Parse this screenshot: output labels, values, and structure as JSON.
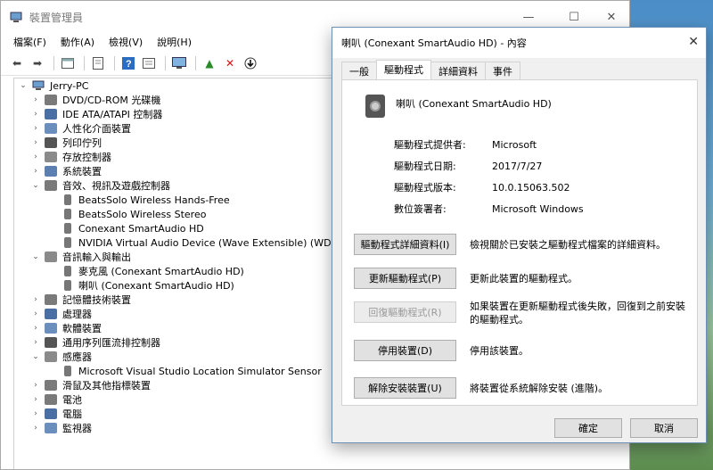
{
  "device_manager": {
    "title": "裝置管理員",
    "menu": [
      "檔案(F)",
      "動作(A)",
      "檢視(V)",
      "說明(H)"
    ],
    "tree": {
      "root": "Jerry-PC",
      "items": [
        {
          "label": "DVD/CD-ROM 光碟機",
          "state": "collapsed",
          "level": 1
        },
        {
          "label": "IDE ATA/ATAPI 控制器",
          "state": "collapsed",
          "level": 1
        },
        {
          "label": "人性化介面裝置",
          "state": "collapsed",
          "level": 1
        },
        {
          "label": "列印佇列",
          "state": "collapsed",
          "level": 1
        },
        {
          "label": "存放控制器",
          "state": "collapsed",
          "level": 1
        },
        {
          "label": "系統裝置",
          "state": "collapsed",
          "level": 1
        },
        {
          "label": "音效、視訊及遊戲控制器",
          "state": "expanded",
          "level": 1
        },
        {
          "label": "BeatsSolo Wireless Hands-Free",
          "state": "leaf",
          "level": 2
        },
        {
          "label": "BeatsSolo Wireless Stereo",
          "state": "leaf",
          "level": 2
        },
        {
          "label": "Conexant SmartAudio HD",
          "state": "leaf",
          "level": 2
        },
        {
          "label": "NVIDIA Virtual Audio Device (Wave Extensible) (WDM)",
          "state": "leaf",
          "level": 2
        },
        {
          "label": "音訊輸入與輸出",
          "state": "expanded",
          "level": 1
        },
        {
          "label": "麥克風 (Conexant SmartAudio HD)",
          "state": "leaf",
          "level": 2
        },
        {
          "label": "喇叭 (Conexant SmartAudio HD)",
          "state": "leaf",
          "level": 2
        },
        {
          "label": "記憶體技術裝置",
          "state": "collapsed",
          "level": 1
        },
        {
          "label": "處理器",
          "state": "collapsed",
          "level": 1
        },
        {
          "label": "軟體裝置",
          "state": "collapsed",
          "level": 1
        },
        {
          "label": "通用序列匯流排控制器",
          "state": "collapsed",
          "level": 1
        },
        {
          "label": "感應器",
          "state": "expanded",
          "level": 1
        },
        {
          "label": "Microsoft Visual Studio Location Simulator Sensor",
          "state": "leaf",
          "level": 2
        },
        {
          "label": "滑鼠及其他指標裝置",
          "state": "collapsed",
          "level": 1
        },
        {
          "label": "電池",
          "state": "collapsed",
          "level": 1
        },
        {
          "label": "電腦",
          "state": "collapsed",
          "level": 1
        },
        {
          "label": "監視器",
          "state": "collapsed",
          "level": 1
        }
      ]
    }
  },
  "properties_dialog": {
    "title": "喇叭 (Conexant SmartAudio HD) - 內容",
    "tabs": [
      "一般",
      "驅動程式",
      "詳細資料",
      "事件"
    ],
    "active_tab": "驅動程式",
    "device_name": "喇叭 (Conexant SmartAudio HD)",
    "fields": [
      {
        "key": "驅動程式提供者:",
        "value": "Microsoft"
      },
      {
        "key": "驅動程式日期:",
        "value": "2017/7/27"
      },
      {
        "key": "驅動程式版本:",
        "value": "10.0.15063.502"
      },
      {
        "key": "數位簽署者:",
        "value": "Microsoft Windows"
      }
    ],
    "actions": [
      {
        "label": "驅動程式詳細資料(I)",
        "desc": "檢視關於已安裝之驅動程式檔案的詳細資料。",
        "enabled": true
      },
      {
        "label": "更新驅動程式(P)",
        "desc": "更新此裝置的驅動程式。",
        "enabled": true
      },
      {
        "label": "回復驅動程式(R)",
        "desc": "如果裝置在更新驅動程式後失敗，回復到之前安裝的驅動程式。",
        "enabled": false
      },
      {
        "label": "停用裝置(D)",
        "desc": "停用該裝置。",
        "enabled": true
      },
      {
        "label": "解除安裝裝置(U)",
        "desc": "將裝置從系統解除安裝 (進階)。",
        "enabled": true
      }
    ],
    "ok_label": "確定",
    "cancel_label": "取消"
  }
}
